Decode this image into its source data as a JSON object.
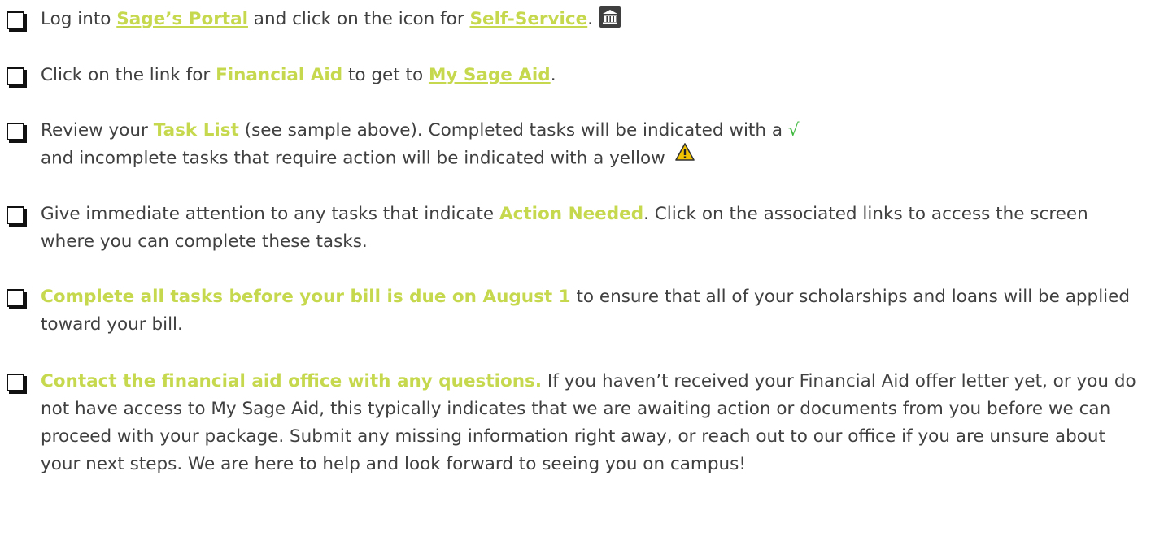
{
  "items": [
    {
      "pre": "Log into ",
      "link1": "Sage’s Portal",
      "mid": " and click on the icon for ",
      "link2": "Self-Service",
      "post": ".",
      "icon": "bank-building-icon"
    },
    {
      "pre": "Click on the link for ",
      "hl": "Financial Aid",
      "mid": " to get to ",
      "link": "My Sage Aid",
      "post": "."
    },
    {
      "pre": "Review your ",
      "hl": "Task List",
      "mid": " (see sample above).  Completed tasks will be indicated with a ",
      "check": "√",
      "post": "and incomplete tasks that require action will be indicated with a yellow ",
      "icon": "warning-triangle-icon"
    },
    {
      "pre": "Give immediate attention to any tasks that indicate ",
      "hl": "Action Needed",
      "post": ". Click on the associated links to access the screen where you can complete these tasks."
    },
    {
      "hl": "Complete all tasks before your bill is due on August 1",
      "post": " to ensure that all of your scholarships and loans will be applied toward your bill."
    },
    {
      "hl": "Contact the financial aid office with any questions.",
      "post": "  If you haven’t received your Financial Aid offer letter yet, or you do not have access to My Sage Aid, this typically indicates that we are awaiting action or documents from you before we can proceed with your package.  Submit any missing information right away, or reach out to our office if you are unsure about your next steps.  We are here to help and look forward to seeing you on campus!"
    }
  ],
  "colors": {
    "highlight": "#c6d94e",
    "check": "#3fb93f",
    "body_text": "#404040",
    "warning": "#f2c300"
  }
}
